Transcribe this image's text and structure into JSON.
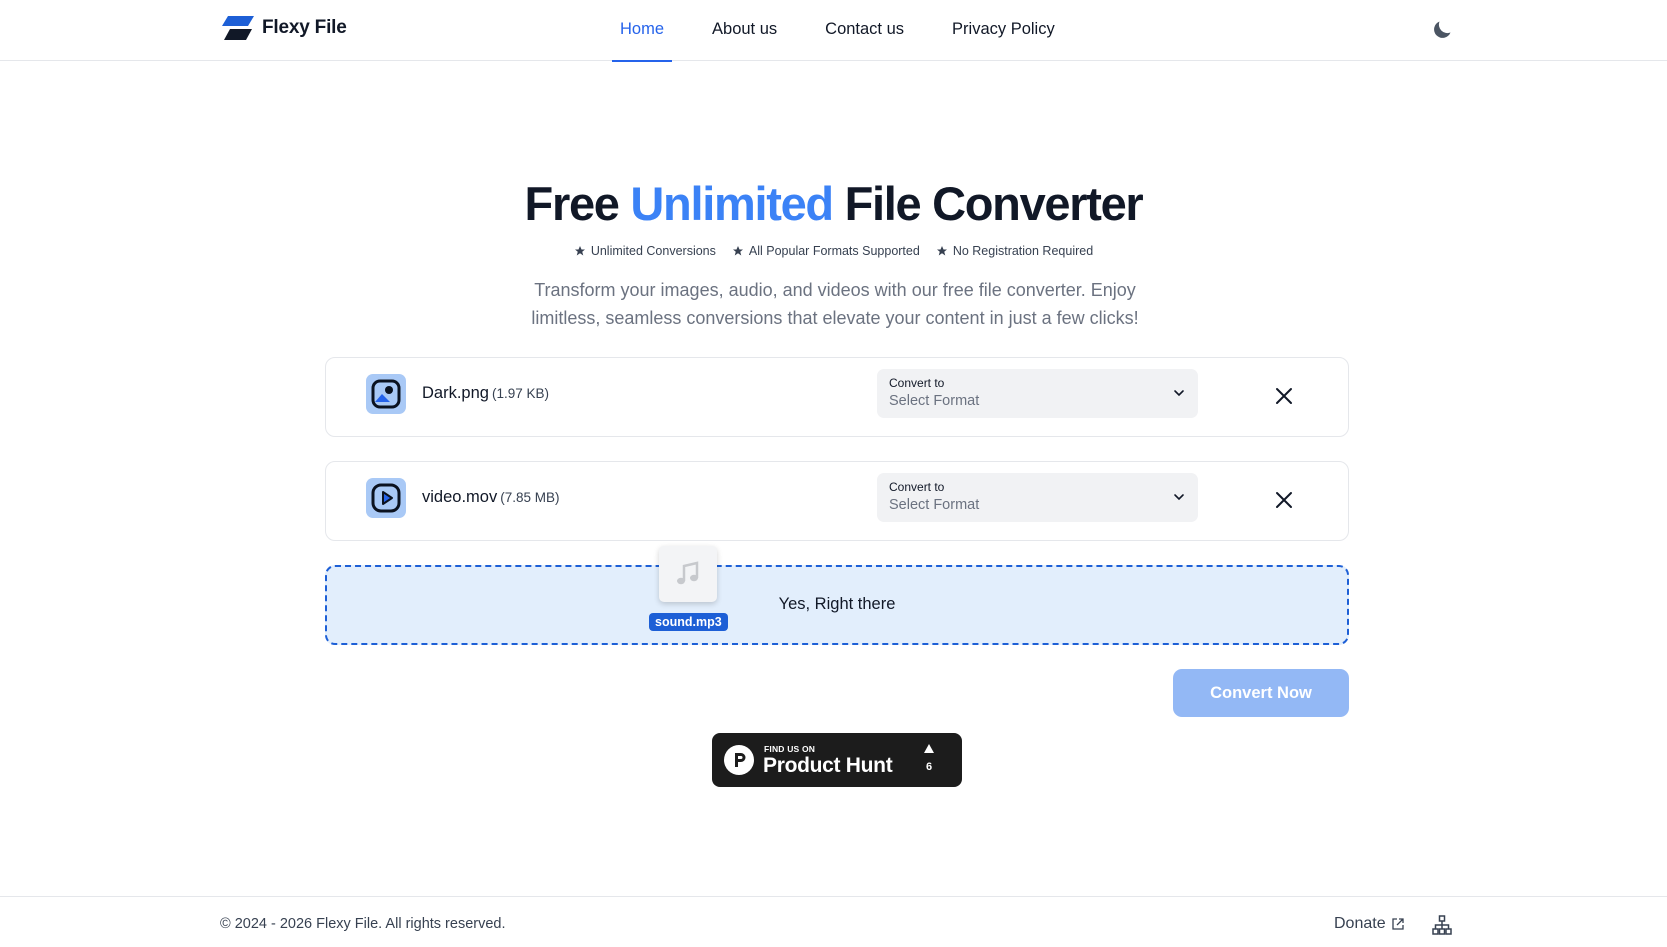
{
  "header": {
    "brand": "Flexy File",
    "nav": [
      {
        "label": "Home",
        "active": true
      },
      {
        "label": "About us",
        "active": false
      },
      {
        "label": "Contact us",
        "active": false
      },
      {
        "label": "Privacy Policy",
        "active": false
      }
    ],
    "theme_icon": "moon-icon"
  },
  "hero": {
    "title_before": "Free",
    "title_accent": "Unlimited",
    "title_after": "File Converter",
    "features": [
      "Unlimited Conversions",
      "All Popular Formats Supported",
      "No Registration Required"
    ],
    "subtitle": "Transform your images, audio, and videos with our free file converter. Enjoy limitless, seamless conversions that elevate your content in just a few clicks!"
  },
  "files": [
    {
      "name": "Dark.png",
      "size": "(1.97 KB)",
      "icon": "image-file-icon",
      "convert_label": "Convert to",
      "format_placeholder": "Select Format"
    },
    {
      "name": "video.mov",
      "size": "(7.85 MB)",
      "icon": "video-file-icon",
      "convert_label": "Convert to",
      "format_placeholder": "Select Format"
    }
  ],
  "dropzone": {
    "text": "Yes, Right there",
    "dragged_file": "sound.mp3",
    "dragged_icon": "music-note-icon"
  },
  "convert_button": "Convert Now",
  "product_hunt": {
    "small": "FIND US ON",
    "big": "Product Hunt",
    "count": "6"
  },
  "footer": {
    "copyright": "© 2024 - 2026 Flexy File. All rights reserved.",
    "donate": "Donate",
    "sitemap_icon": "sitemap-icon"
  },
  "colors": {
    "accent": "#2563eb",
    "accent_light": "#3b82f6",
    "dropzone_bg": "#e2eefc",
    "convert_disabled": "#93b8f5"
  }
}
